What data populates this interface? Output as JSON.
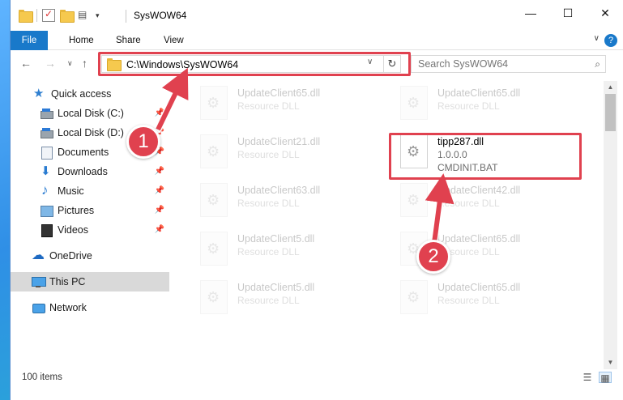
{
  "window": {
    "title": "SysWOW64",
    "controls": {
      "minimize": "—",
      "maximize": "☐",
      "close": "✕"
    }
  },
  "ribbon": {
    "tabs": [
      "File",
      "Home",
      "Share",
      "View"
    ],
    "help": "?",
    "collapse": "∨"
  },
  "nav": {
    "back": "←",
    "forward": "→",
    "recent": "∨",
    "up": "↑",
    "address": "C:\\Windows\\SysWOW64",
    "refresh": "↻",
    "search_placeholder": "Search SysWOW64",
    "search_icon": "⌕"
  },
  "sidebar": {
    "items": [
      {
        "label": "Quick access",
        "icon": "star-icon"
      },
      {
        "label": "Local Disk (C:)",
        "icon": "disk-icon",
        "pinned": true
      },
      {
        "label": "Local Disk (D:)",
        "icon": "disk-icon",
        "pinned": true
      },
      {
        "label": "Documents",
        "icon": "documents-icon",
        "pinned": true
      },
      {
        "label": "Downloads",
        "icon": "downloads-icon",
        "pinned": true
      },
      {
        "label": "Music",
        "icon": "music-icon",
        "pinned": true
      },
      {
        "label": "Pictures",
        "icon": "pictures-icon",
        "pinned": true
      },
      {
        "label": "Videos",
        "icon": "videos-icon",
        "pinned": true
      },
      {
        "label": "OneDrive",
        "icon": "onedrive-icon"
      },
      {
        "label": "This PC",
        "icon": "pc-icon",
        "selected": true
      },
      {
        "label": "Network",
        "icon": "network-icon"
      }
    ],
    "pin_glyph": "📌"
  },
  "files": {
    "left": [
      {
        "name": "UpdateClient65.dll",
        "type": "Resource DLL"
      },
      {
        "name": "UpdateClient21.dll",
        "type": "Resource DLL"
      },
      {
        "name": "UpdateClient63.dll",
        "type": "Resource DLL"
      },
      {
        "name": "UpdateClient5.dll",
        "type": "Resource DLL"
      },
      {
        "name": "UpdateClient5.dll",
        "type": "Resource DLL"
      }
    ],
    "right": [
      {
        "name": "UpdateClient65.dll",
        "type": "Resource DLL"
      },
      {
        "name": "UpdateClient42.dll",
        "type": "Resource DLL"
      },
      {
        "name": "UpdateClient65.dll",
        "type": "Resource DLL"
      },
      {
        "name": "UpdateClient65.dll",
        "type": "Resource DLL"
      }
    ],
    "highlighted": {
      "name": "tipp287.dll",
      "version": "1.0.0.0",
      "description": "CMDINIT.BAT"
    }
  },
  "status": {
    "item_count": "100 items"
  },
  "callouts": {
    "one": "1",
    "two": "2"
  },
  "colors": {
    "accent": "#1979ca",
    "callout": "#e0414f",
    "selected": "#d9d9d9"
  }
}
